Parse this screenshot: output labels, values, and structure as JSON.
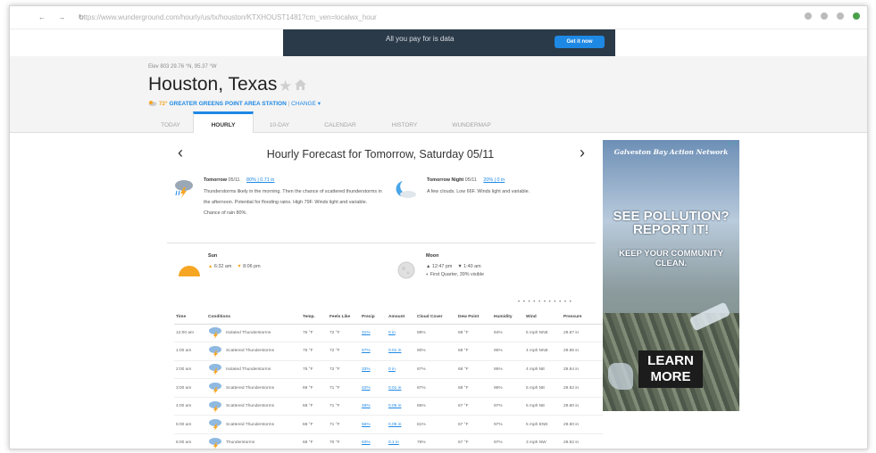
{
  "browser": {
    "nav": "← → ↻",
    "url": "https://www.wunderground.com/hourly/us/tx/houston/KTXHOUST1481?cm_ven=localwx_hour"
  },
  "top_ad": {
    "text": "All you pay for is data",
    "button": "Get it now"
  },
  "header": {
    "coords": "Elev 803 29.76 °N, 95.37 °W",
    "city": "Houston, Texas",
    "star": "★",
    "temp": "72°",
    "station": "GREATER GREENS POINT AREA STATION",
    "sep": "|",
    "change": "CHANGE ▾"
  },
  "tabs": [
    "TODAY",
    "HOURLY",
    "10-DAY",
    "CALENDAR",
    "HISTORY",
    "WUNDERMAP"
  ],
  "forecast": {
    "prev": "‹",
    "next": "›",
    "title": "Hourly Forecast for Tomorrow, Saturday 05/11",
    "day": {
      "head": "Tomorrow",
      "date": "05/11",
      "precip": "80% | 0.71 in",
      "text": "Thunderstorms likely in the morning. Then the chance of scattered thunderstorms in the afternoon. Potential for flooding rains. High 79F. Winds light and variable. Chance of rain 80%."
    },
    "night": {
      "head": "Tomorrow Night",
      "date": "05/11",
      "precip": "20% | 0 in",
      "text": "A few clouds. Low 66F. Winds light and variable."
    },
    "sun": {
      "head": "Sun",
      "rise": "6:32 am",
      "set": "8:06 pm"
    },
    "moon": {
      "head": "Moon",
      "rise": "12:47 pm",
      "set": "1:40 am",
      "phase": "First Quarter, 39% visible"
    },
    "dots": "• • • • • • • • • • •"
  },
  "table": {
    "headers": [
      "Time",
      "Conditions",
      "Temp.",
      "Feels Like",
      "Precip",
      "Amount",
      "Cloud Cover",
      "Dew Point",
      "Humidity",
      "Wind",
      "Pressure"
    ],
    "rows": [
      [
        "12:00 am",
        "Isolated Thunderstorms",
        "75 °F",
        "72 °F",
        "31%",
        "0 in",
        "88%",
        "68 °F",
        "94%",
        "5 mph NNE",
        "29.87 in"
      ],
      [
        "1:00 am",
        "Scattered Thunderstorms",
        "75 °F",
        "72 °F",
        "57%",
        "0.01 in",
        "90%",
        "68 °F",
        "95%",
        "4 mph NNE",
        "29.86 in"
      ],
      [
        "2:00 am",
        "Isolated Thunderstorms",
        "75 °F",
        "72 °F",
        "33%",
        "0 in",
        "87%",
        "68 °F",
        "95%",
        "4 mph NE",
        "29.84 in"
      ],
      [
        "3:00 am",
        "Scattered Thunderstorms",
        "69 °F",
        "71 °F",
        "42%",
        "0.01 in",
        "87%",
        "68 °F",
        "96%",
        "5 mph NE",
        "29.82 in"
      ],
      [
        "4:00 am",
        "Scattered Thunderstorms",
        "68 °F",
        "71 °F",
        "48%",
        "0.05 in",
        "85%",
        "67 °F",
        "97%",
        "5 mph NE",
        "29.80 in"
      ],
      [
        "5:00 am",
        "Scattered Thunderstorms",
        "68 °F",
        "71 °F",
        "56%",
        "0.09 in",
        "81%",
        "67 °F",
        "97%",
        "5 mph ENE",
        "29.80 in"
      ],
      [
        "6:00 am",
        "Thunderstorms",
        "68 °F",
        "70 °F",
        "83%",
        "0.1 in",
        "79%",
        "67 °F",
        "97%",
        "3 mph NW",
        "29.82 in"
      ]
    ]
  },
  "side_ad": {
    "org": "Galveston Bay Action Network",
    "choices": "▷ ×",
    "headline": "SEE POLLUTION? REPORT IT!",
    "sub": "KEEP YOUR COMMUNITY CLEAN.",
    "cta": "LEARN MORE"
  },
  "colors": {
    "accent": "#1e88e5",
    "sun": "#f6a623",
    "ad_bg": "#2b3a49"
  }
}
